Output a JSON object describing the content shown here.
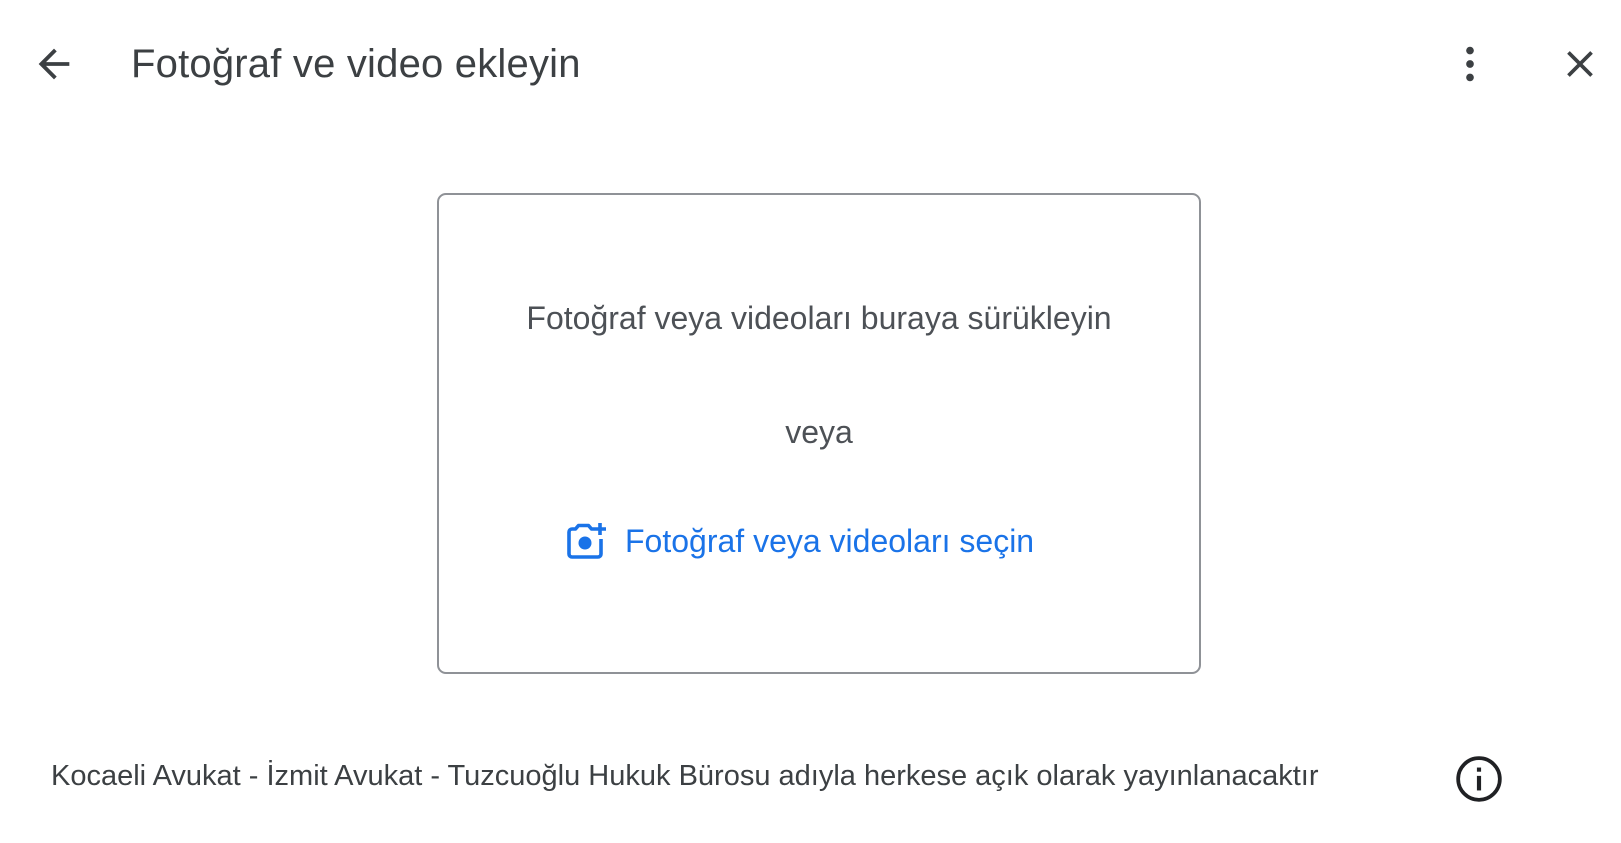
{
  "header": {
    "title": "Fotoğraf ve video ekleyin",
    "back_icon": "arrow-back-icon",
    "more_icon": "more-vert-icon",
    "close_icon": "close-icon"
  },
  "dropzone": {
    "drag_text": "Fotoğraf veya videoları buraya sürükleyin",
    "or_text": "veya",
    "select_label": "Fotoğraf veya videoları seçin",
    "select_icon": "add-photo-camera-icon"
  },
  "footer": {
    "notice": "Kocaeli Avukat - İzmit Avukat - Tuzcuoğlu Hukuk Bürosu adıyla herkese açık olarak yayınlanacaktır",
    "info_icon": "info-icon"
  },
  "colors": {
    "accent": "#1a73e8",
    "text": "#3c4043",
    "border": "#8f9297"
  }
}
